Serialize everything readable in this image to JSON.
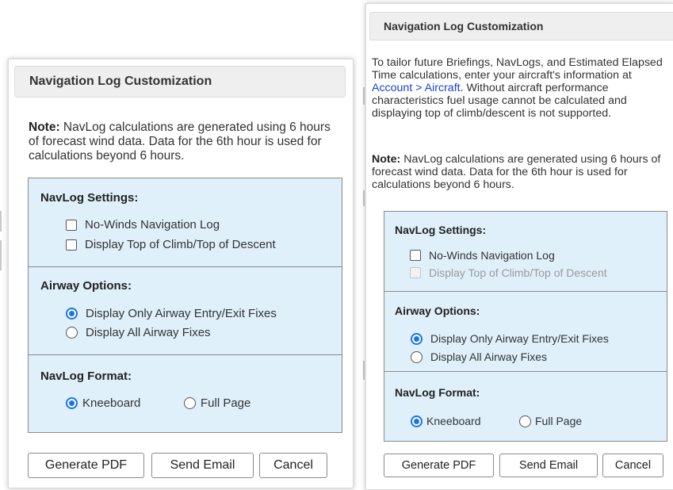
{
  "left_dialog": {
    "title": "Navigation Log Customization",
    "note_label": "Note:",
    "note_text": " NavLog calculations are generated using 6 hours of forecast wind data. Data for the 6th hour is used for calculations beyond 6 hours.",
    "navlog_settings": {
      "title": "NavLog Settings:",
      "no_winds": "No-Winds Navigation Log",
      "toc_tod": "Display Top of Climb/Top of Descent"
    },
    "airway_options": {
      "title": "Airway Options:",
      "entry_exit": "Display Only Airway Entry/Exit Fixes",
      "all_fixes": "Display All Airway Fixes"
    },
    "navlog_format": {
      "title": "NavLog Format:",
      "kneeboard": "Kneeboard",
      "full_page": "Full Page"
    },
    "buttons": {
      "generate_pdf": "Generate PDF",
      "send_email": "Send Email",
      "cancel": "Cancel"
    }
  },
  "right_dialog": {
    "title": "Navigation Log Customization",
    "intro_before_link": "To tailor future Briefings, NavLogs, and Estimated Elapsed Time calculations, enter your aircraft's information at ",
    "intro_link": "Account > Aircraft",
    "intro_after_link": ". Without aircraft performance characteristics fuel usage cannot be calculated and displaying top of climb/descent is not supported.",
    "note_label": "Note:",
    "note_text": " NavLog calculations are generated using 6 hours of forecast wind data. Data for the 6th hour is used for calculations beyond 6 hours.",
    "navlog_settings": {
      "title": "NavLog Settings:",
      "no_winds": "No-Winds Navigation Log",
      "toc_tod": "Display Top of Climb/Top of Descent"
    },
    "airway_options": {
      "title": "Airway Options:",
      "entry_exit": "Display Only Airway Entry/Exit Fixes",
      "all_fixes": "Display All Airway Fixes"
    },
    "navlog_format": {
      "title": "NavLog Format:",
      "kneeboard": "Kneeboard",
      "full_page": "Full Page"
    },
    "buttons": {
      "generate_pdf": "Generate PDF",
      "send_email": "Send Email",
      "cancel": "Cancel"
    }
  },
  "colors": {
    "panel_bg": "#dff0fa",
    "title_bg": "#efefef",
    "radio_accent": "#1a73e8",
    "link": "#1a3fd8"
  }
}
